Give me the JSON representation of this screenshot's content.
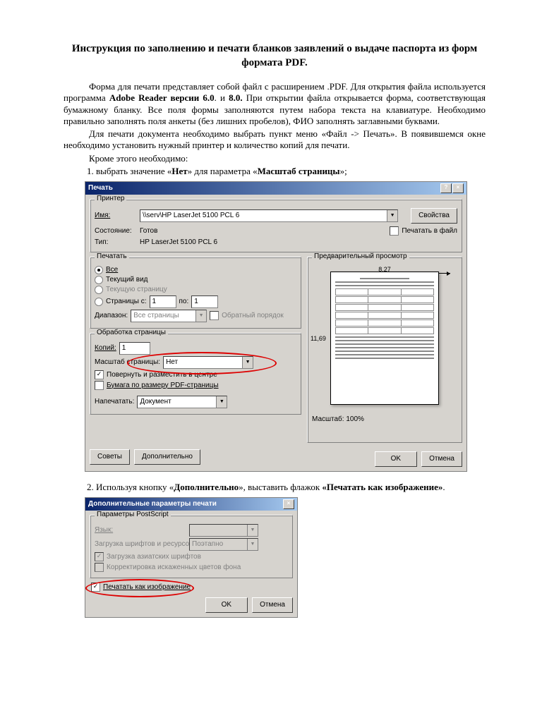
{
  "title": "Инструкция по заполнению и печати бланков заявлений о выдаче паспорта из форм формата PDF.",
  "p1a": "Форма для печати представляет собой файл с расширением .PDF. Для открытия файла используется программа ",
  "p1b": "Adobe Reader версии 6.0",
  "p1c": ". и ",
  "p1d": "8.0.",
  "p1e": " При открытии файла открывается форма, соответствующая бумажному бланку. Все поля формы заполняются путем набора текста на клавиатуре. Необходимо правильно заполнять поля анкеты (без лишних пробелов), ФИО заполнять заглавными буквами.",
  "p2": "Для печати документа необходимо выбрать пункт меню «Файл -> Печать». В появившемся окне необходимо установить нужный принтер и количество копий для печати.",
  "p3": "Кроме этого необходимо:",
  "li1a": "выбрать значение «",
  "li1b": "Нет",
  "li1c": "» для параметра «",
  "li1d": "Масштаб страницы",
  "li1e": "»;",
  "li2a": "Используя ",
  "li2sp": "кнопку",
  "li2b": " «",
  "li2c": "Дополнительно",
  "li2d": "», выставить флажок ",
  "li2e": "«Печатать как изображение»",
  "li2f": ".",
  "print": {
    "title": "Печать",
    "help": "?",
    "close": "×",
    "grp_printer": "Принтер",
    "name_lbl": "Имя:",
    "name_val": "\\\\serv\\HP LaserJet 5100 PCL 6",
    "props": "Свойства",
    "state_lbl": "Состояние:",
    "state_val": "Готов",
    "to_file": "Печатать в файл",
    "type_lbl": "Тип:",
    "type_val": "HP LaserJet 5100 PCL 6",
    "grp_range": "Печатать",
    "r_all": "Все",
    "r_view": "Текущий вид",
    "r_page": "Текущую страницу",
    "r_pages": "Страницы  с:",
    "to": "по:",
    "page_from": "1",
    "page_to": "1",
    "diapazon": "Диапазон:",
    "all_pages": "Все страницы",
    "reverse": "Обратный порядок",
    "grp_handle": "Обработка страницы",
    "copies": "Копий:",
    "copies_val": "1",
    "scale_lbl": "Масштаб страницы:",
    "scale_val": "Нет",
    "rotate": "Повернуть и разместить в центре",
    "pdfsize": "Бумага по размеру PDF-страницы",
    "print_what": "Напечатать:",
    "doc": "Документ",
    "grp_preview": "Предварительный просмотр",
    "w": "8,27",
    "h": "11,69",
    "zoom": "Масштаб: 100%",
    "tips": "Советы",
    "advanced": "Дополнительно",
    "ok": "OK",
    "cancel": "Отмена"
  },
  "adv": {
    "title": "Дополнительные параметры печати",
    "close": "×",
    "grp": "Параметры PostScript",
    "lang": "Язык:",
    "fonts": "Загрузка шрифтов и ресурсов:",
    "fonts_val": "Поэтапно",
    "asian": "Загрузка азиатских шрифтов",
    "color": "Корректировка искаженных цветов фона",
    "as_img": "Печатать как изображение",
    "ok": "OK",
    "cancel": "Отмена"
  }
}
